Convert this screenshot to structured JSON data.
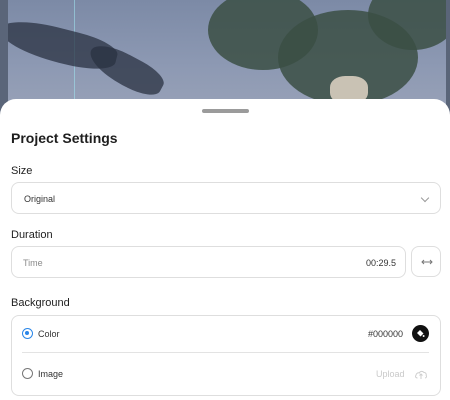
{
  "sheet": {
    "title": "Project Settings"
  },
  "size": {
    "label": "Size",
    "value": "Original"
  },
  "duration": {
    "label": "Duration",
    "placeholder": "Time",
    "value": "00:29.5"
  },
  "background": {
    "label": "Background",
    "color_option_label": "Color",
    "color_value": "#000000",
    "color_selected": true,
    "image_option_label": "Image",
    "upload_label": "Upload"
  },
  "colors": {
    "accent": "#2a86e8",
    "swatch": "#000000"
  },
  "icons": {
    "swap": "swap-horizontal-icon",
    "paint": "paint-bucket-icon",
    "upload": "cloud-upload-icon",
    "dropdown": "chevron-down-icon"
  }
}
